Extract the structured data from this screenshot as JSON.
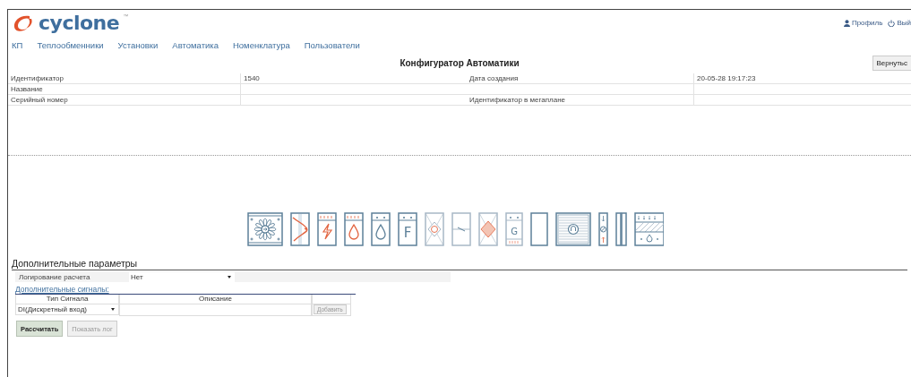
{
  "header": {
    "brand": "cyclone",
    "trademark": "™",
    "user_links": [
      {
        "kind": "profile",
        "label": "Профиль"
      },
      {
        "kind": "logout",
        "label": "Вый"
      }
    ]
  },
  "nav": [
    "КП",
    "Теплообменники",
    "Установки",
    "Автоматика",
    "Номенклатура",
    "Пользователи"
  ],
  "page": {
    "title": "Конфигуратор Автоматики",
    "back_button": "Вернутьс"
  },
  "info_rows": [
    {
      "cells": [
        {
          "label": "Идентификатор",
          "value": "1540"
        },
        {
          "label": "Дата создания",
          "value": "20-05-28 19:17:23"
        }
      ]
    },
    {
      "cells": [
        {
          "label": "Название"
        }
      ]
    },
    {
      "cells": [
        {
          "label": "Серийный номер"
        },
        {
          "label": "Идентификатор в мегаплане"
        }
      ]
    }
  ],
  "modules": [
    {
      "kind": "fan"
    },
    {
      "kind": "recuperator"
    },
    {
      "kind": "electric"
    },
    {
      "kind": "water-heater"
    },
    {
      "kind": "water-cooler"
    },
    {
      "kind": "freon",
      "label": "F"
    },
    {
      "kind": "rotor"
    },
    {
      "kind": "damper"
    },
    {
      "kind": "plate"
    },
    {
      "kind": "gas",
      "label": "G"
    },
    {
      "kind": "blank"
    },
    {
      "kind": "silencer"
    },
    {
      "kind": "valve"
    },
    {
      "kind": "double"
    },
    {
      "kind": "humidifier"
    }
  ],
  "extra": {
    "title": "Дополнительные параметры",
    "logging": {
      "label": "Логирование расчета",
      "value": "Нет"
    },
    "signals_link": "Дополнительные сигналы:",
    "signals_table": {
      "columns": [
        "Тип Сигнала",
        "Описание"
      ],
      "type_value": "DI(Дискретный вход)",
      "add_button": {
        "label": "Добавить",
        "disabled": true
      }
    },
    "actions": [
      {
        "label": "Рассчитать",
        "disabled": false
      },
      {
        "label": "Показать лог",
        "disabled": true
      }
    ]
  }
}
